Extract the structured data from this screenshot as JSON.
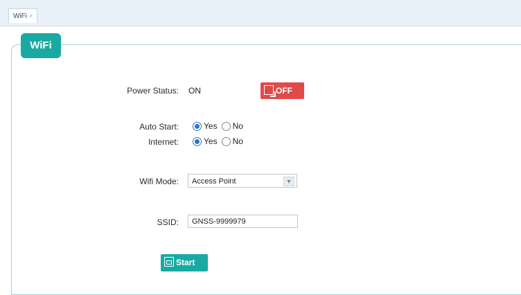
{
  "tabs": [
    {
      "label": "WiFi",
      "close": "×"
    }
  ],
  "panel": {
    "title": "WiFi"
  },
  "power": {
    "label": "Power Status:",
    "value": "ON",
    "button_label": "OFF",
    "button_color": "#e24a4a"
  },
  "auto_start": {
    "label": "Auto Start:",
    "options": [
      "Yes",
      "No"
    ],
    "selected": "Yes"
  },
  "internet": {
    "label": "Internet:",
    "options": [
      "Yes",
      "No"
    ],
    "selected": "Yes"
  },
  "wifi_mode": {
    "label": "Wifi Mode:",
    "value": "Access Point",
    "icon": "chevron-down-icon"
  },
  "ssid": {
    "label": "SSID:",
    "value": "GNSS-9999979"
  },
  "start": {
    "label": "Start",
    "icon": "save-icon",
    "color": "#1aa9a2"
  },
  "colors": {
    "accent": "#1aa9a2",
    "danger": "#e24a4a",
    "tabbar": "#e8f0f8"
  }
}
